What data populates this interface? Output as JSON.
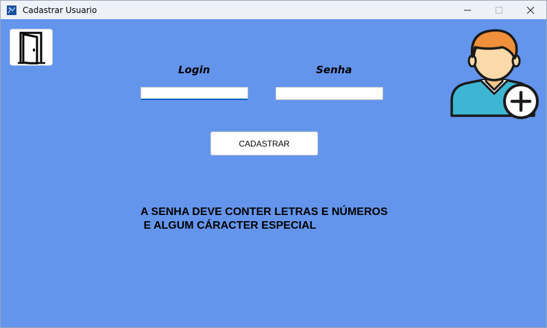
{
  "window": {
    "title": "Cadastrar Usuario",
    "controls": {
      "minimize": "—",
      "maximize": "☐",
      "close": "✕"
    }
  },
  "icons": {
    "app": "app-icon",
    "door": "door-exit-icon",
    "avatar": "user-add-icon"
  },
  "form": {
    "login_label": "Login",
    "senha_label": "Senha",
    "login_value": "",
    "senha_value": "",
    "submit_label": "CADASTRAR"
  },
  "message": {
    "line1": "A SENHA DEVE CONTER LETRAS E NÚMEROS",
    "line2": " E ALGUM CÁRACTER ESPECIAL"
  },
  "colors": {
    "background": "#6495ED",
    "titlebar": "#eef2f8",
    "avatar_hair": "#F0903A",
    "avatar_skin": "#FCD9A8",
    "avatar_shirt": "#3EB6D3"
  }
}
